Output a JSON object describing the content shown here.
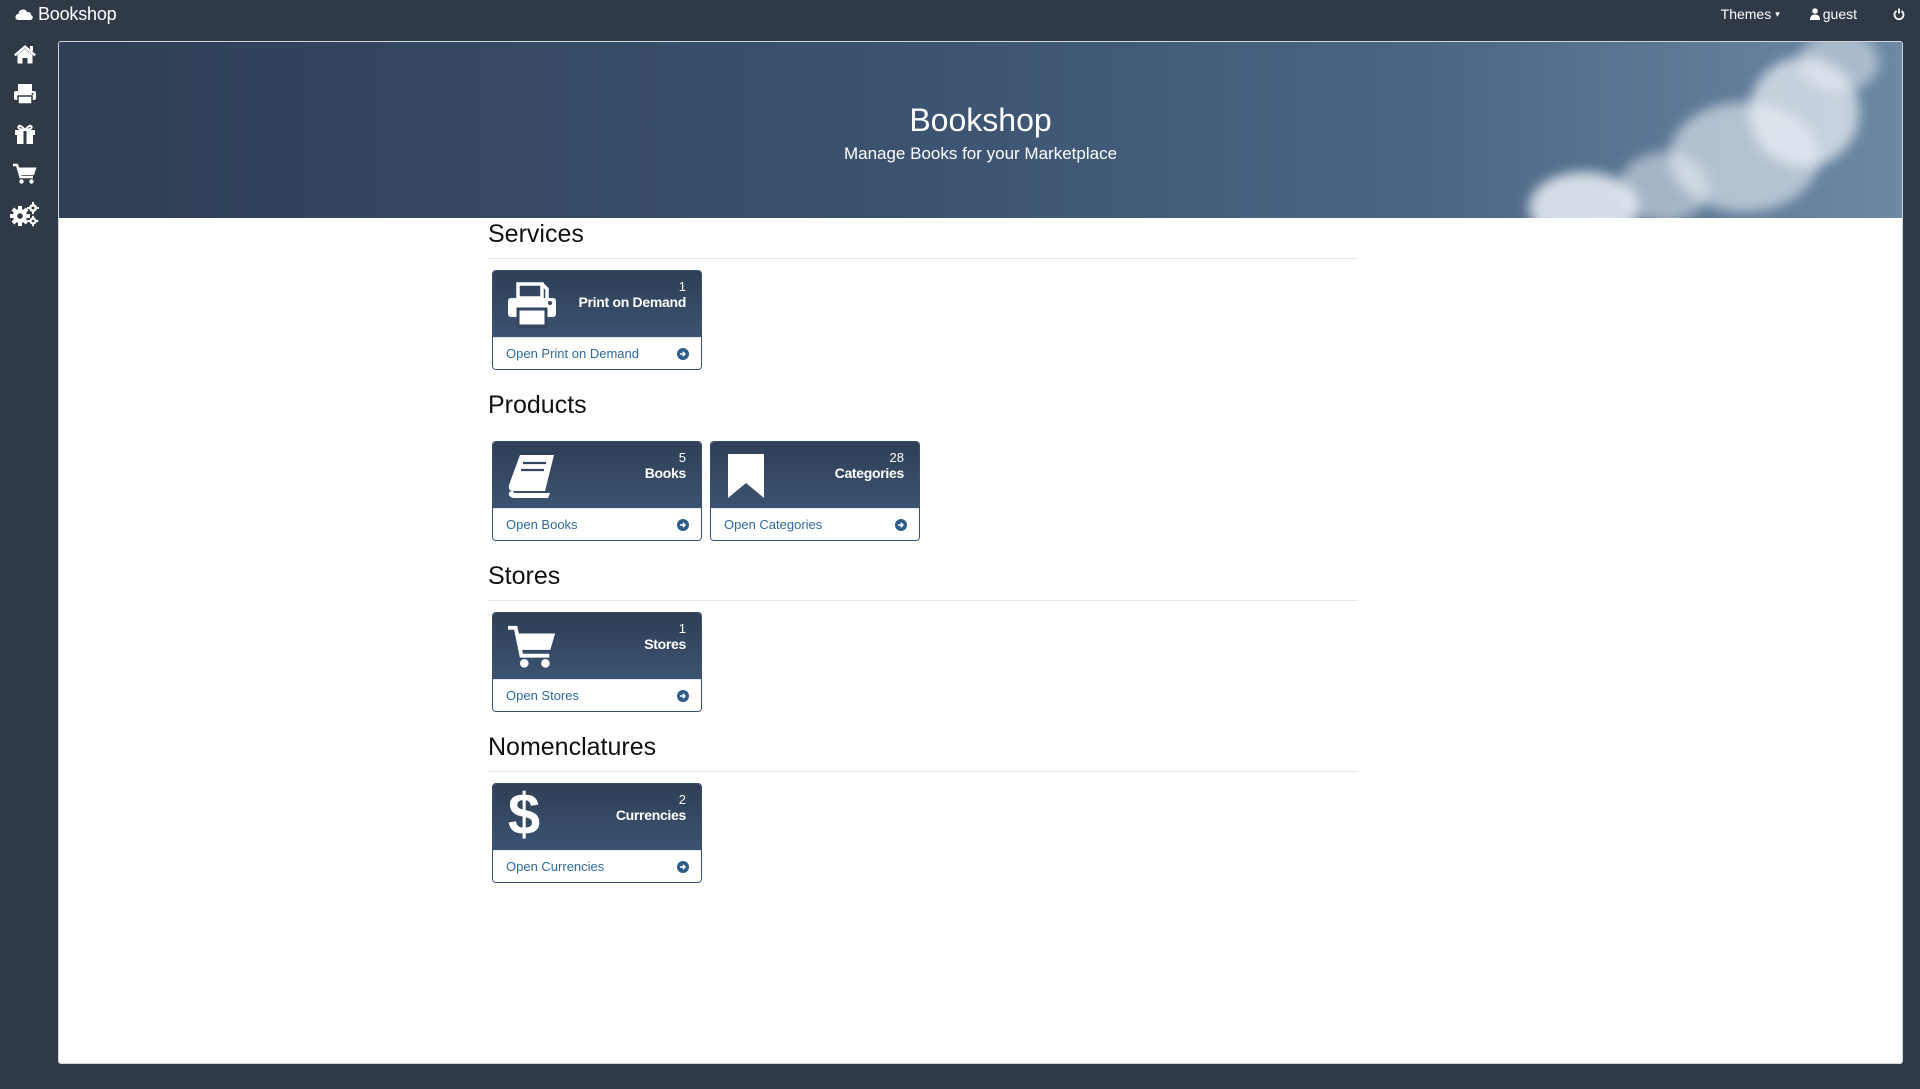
{
  "app": {
    "brand": "Bookshop"
  },
  "topbar": {
    "themes_label": "Themes",
    "user_label": "guest"
  },
  "sidebar": {
    "items": [
      {
        "icon": "home-icon"
      },
      {
        "icon": "print-icon"
      },
      {
        "icon": "gift-icon"
      },
      {
        "icon": "cart-icon"
      },
      {
        "icon": "gears-icon"
      }
    ]
  },
  "hero": {
    "title": "Bookshop",
    "subtitle": "Manage Books for your Marketplace"
  },
  "sections": [
    {
      "title": "Services",
      "tiles": [
        {
          "count": "1",
          "label": "Print on Demand",
          "link": "Open Print on Demand",
          "icon": "print-icon"
        }
      ]
    },
    {
      "title": "Products",
      "tiles": [
        {
          "count": "5",
          "label": "Books",
          "link": "Open Books",
          "icon": "book-icon"
        },
        {
          "count": "28",
          "label": "Categories",
          "link": "Open Categories",
          "icon": "bookmark-icon"
        }
      ]
    },
    {
      "title": "Stores",
      "tiles": [
        {
          "count": "1",
          "label": "Stores",
          "link": "Open Stores",
          "icon": "cart-icon"
        }
      ]
    },
    {
      "title": "Nomenclatures",
      "tiles": [
        {
          "count": "2",
          "label": "Currencies",
          "link": "Open Currencies",
          "icon": "dollar-icon"
        }
      ]
    }
  ],
  "colors": {
    "background": "#303a46",
    "tile_head": "#34465f",
    "link": "#2f6a9e"
  }
}
